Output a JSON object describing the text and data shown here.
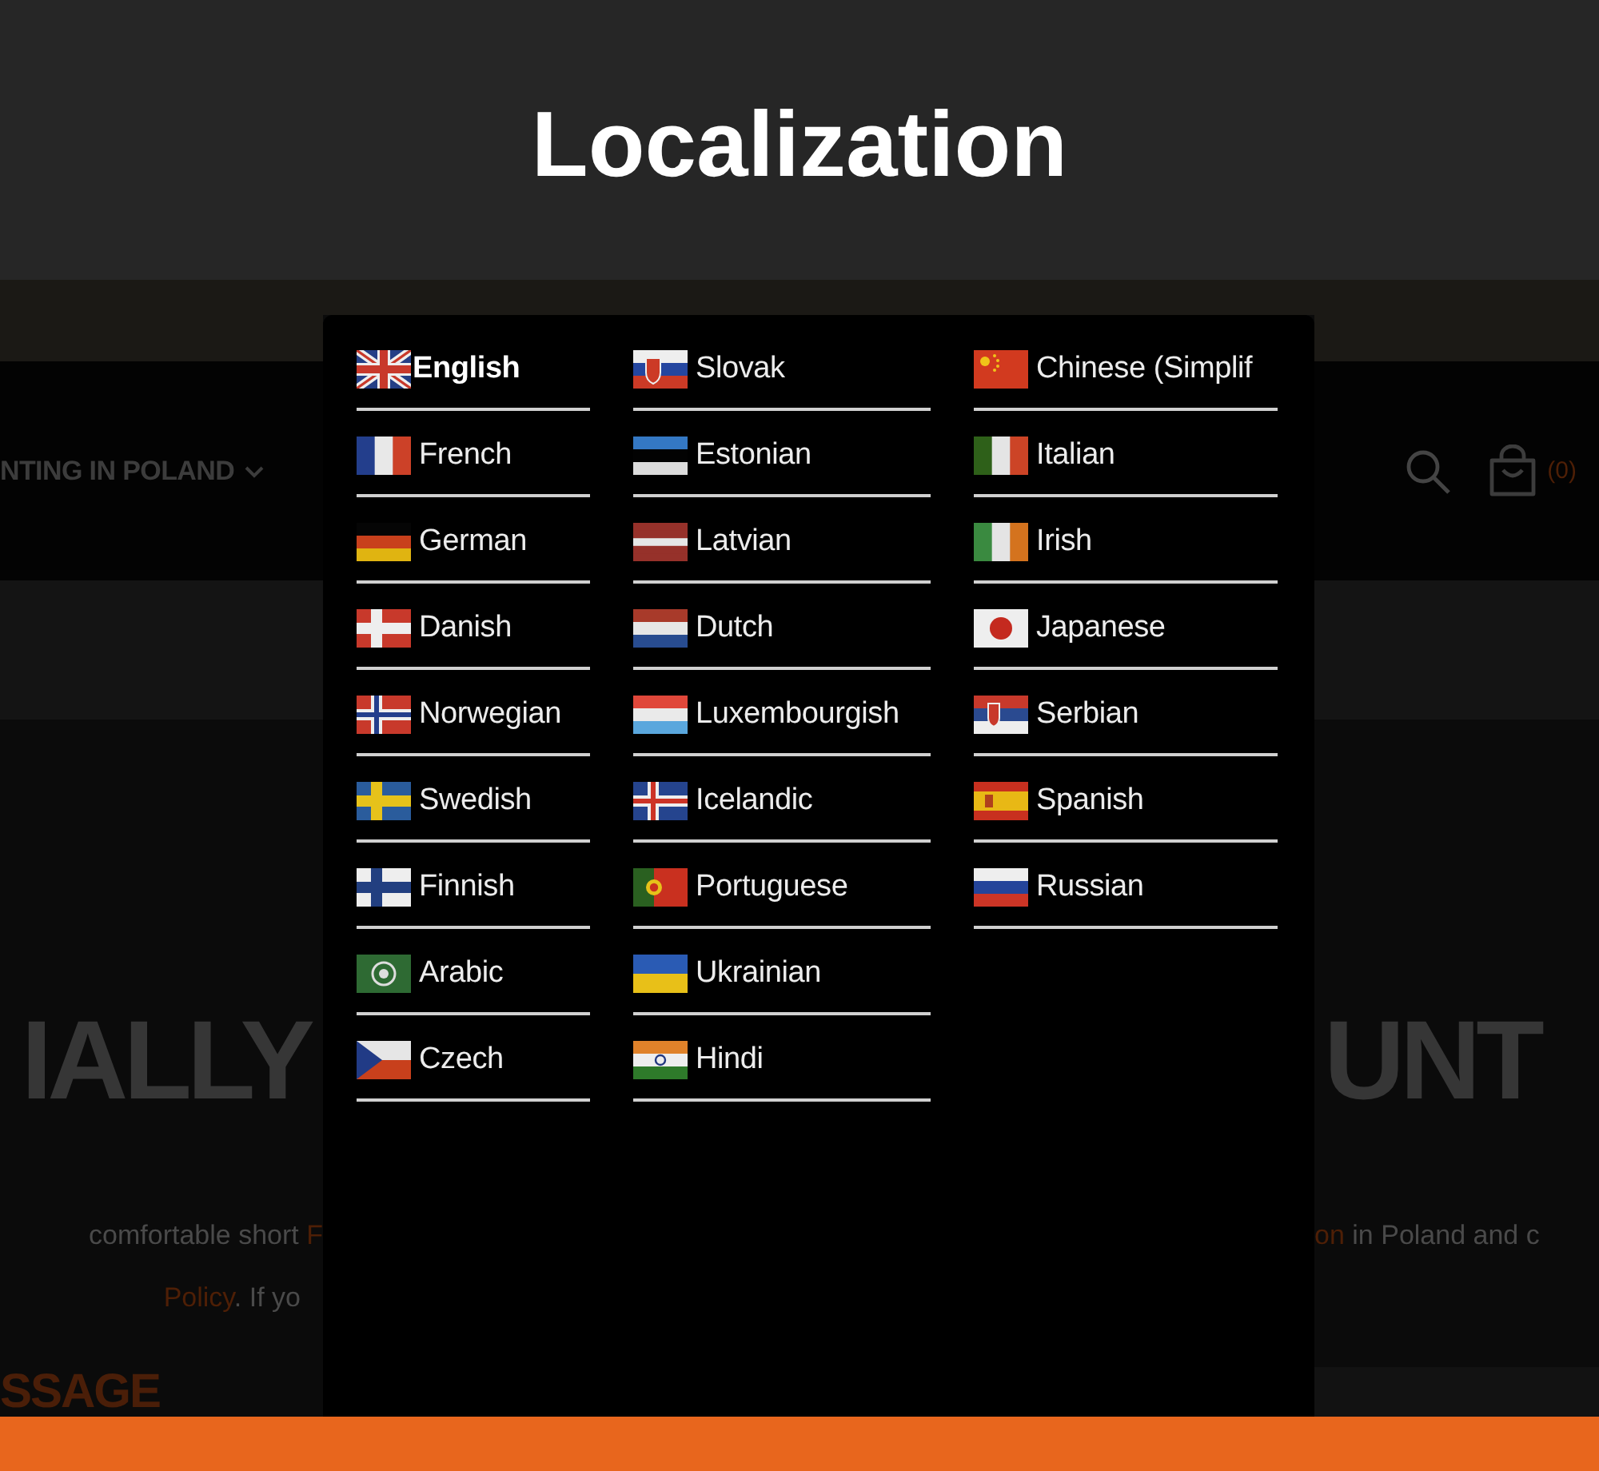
{
  "title": "Localization",
  "page_behind": {
    "nav_link": "NTING IN POLAND",
    "cart_count": "(0)",
    "headline_left": "IALLY",
    "headline_right": "UNT",
    "text_left": [
      {
        "segments": [
          {
            "text": "comfortable short ",
            "kind": "plain"
          },
          {
            "text": "F",
            "kind": "link"
          }
        ]
      },
      {
        "segments": [
          {
            "text": "Policy",
            "kind": "link"
          },
          {
            "text": ". If yo",
            "kind": "plain"
          }
        ]
      }
    ],
    "text_right": [
      {
        "segments": [
          {
            "text": "on",
            "kind": "link"
          },
          {
            "text": " in Poland and c",
            "kind": "plain"
          }
        ]
      }
    ],
    "section_heading": "SSAGE"
  },
  "language_menu": {
    "columns": [
      [
        {
          "label": "English",
          "selected": true
        },
        {
          "label": "French",
          "selected": false
        },
        {
          "label": "German",
          "selected": false
        },
        {
          "label": "Danish",
          "selected": false
        },
        {
          "label": "Norwegian",
          "selected": false
        },
        {
          "label": "Swedish",
          "selected": false
        },
        {
          "label": "Finnish",
          "selected": false
        },
        {
          "label": "Arabic",
          "selected": false
        },
        {
          "label": "Czech",
          "selected": false
        }
      ],
      [
        {
          "label": "Slovak",
          "selected": false
        },
        {
          "label": "Estonian",
          "selected": false
        },
        {
          "label": "Latvian",
          "selected": false
        },
        {
          "label": "Dutch",
          "selected": false
        },
        {
          "label": "Luxembourgish",
          "selected": false
        },
        {
          "label": "Icelandic",
          "selected": false
        },
        {
          "label": "Portuguese",
          "selected": false
        },
        {
          "label": "Ukrainian",
          "selected": false
        },
        {
          "label": "Hindi",
          "selected": false
        }
      ],
      [
        {
          "label": "Chinese (Simplif",
          "selected": false
        },
        {
          "label": "Italian",
          "selected": false
        },
        {
          "label": "Irish",
          "selected": false
        },
        {
          "label": "Japanese",
          "selected": false
        },
        {
          "label": "Serbian",
          "selected": false
        },
        {
          "label": "Spanish",
          "selected": false
        },
        {
          "label": "Russian",
          "selected": false
        }
      ]
    ]
  }
}
